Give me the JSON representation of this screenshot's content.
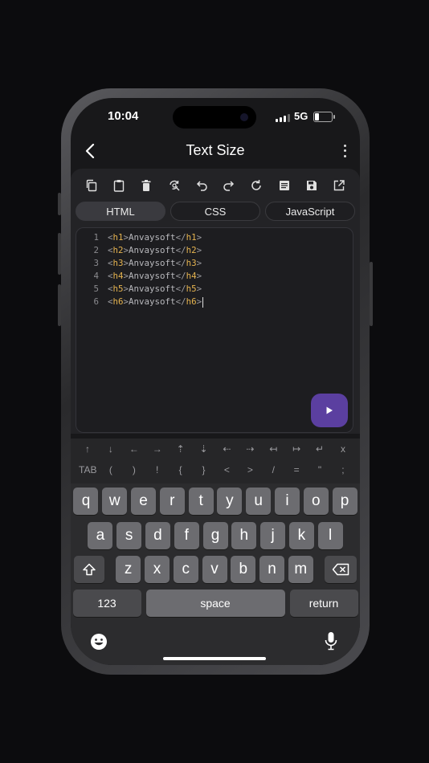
{
  "status_bar": {
    "time": "10:04",
    "network": "5G"
  },
  "nav": {
    "title": "Text Size"
  },
  "toolbar": [
    "copy-icon",
    "paste-icon",
    "delete-icon",
    "search-replace-icon",
    "undo-icon",
    "redo-icon",
    "refresh-icon",
    "document-icon",
    "save-icon",
    "share-icon"
  ],
  "tabs": {
    "html": "HTML",
    "css": "CSS",
    "js": "JavaScript",
    "active": "html"
  },
  "editor": {
    "lines": [
      {
        "num": "1",
        "open": "h1",
        "text": "Anvaysoft",
        "close": "h1"
      },
      {
        "num": "2",
        "open": "h2",
        "text": "Anvaysoft",
        "close": "h2"
      },
      {
        "num": "3",
        "open": "h3",
        "text": "Anvaysoft",
        "close": "h3"
      },
      {
        "num": "4",
        "open": "h4",
        "text": "Anvaysoft",
        "close": "h4"
      },
      {
        "num": "5",
        "open": "h5",
        "text": "Anvaysoft",
        "close": "h5"
      },
      {
        "num": "6",
        "open": "h6",
        "text": "Anvaysoft",
        "close": "h6"
      }
    ]
  },
  "accessory": {
    "row1": [
      "↑",
      "↓",
      "←",
      "→",
      "⇡",
      "⇣",
      "⇠",
      "⇢",
      "↤",
      "↦",
      "↵",
      "x"
    ],
    "row2": [
      "TAB",
      "(",
      ")",
      "!",
      "{",
      "}",
      "<",
      ">",
      "/",
      "=",
      "\"",
      ";"
    ]
  },
  "keyboard": {
    "row1": [
      "q",
      "w",
      "e",
      "r",
      "t",
      "y",
      "u",
      "i",
      "o",
      "p"
    ],
    "row2": [
      "a",
      "s",
      "d",
      "f",
      "g",
      "h",
      "j",
      "k",
      "l"
    ],
    "row3": [
      "z",
      "x",
      "c",
      "v",
      "b",
      "n",
      "m"
    ],
    "numbers": "123",
    "space": "space",
    "return": "return"
  },
  "colors": {
    "run_button": "#5b3fa0",
    "tag": "#e6b450"
  }
}
